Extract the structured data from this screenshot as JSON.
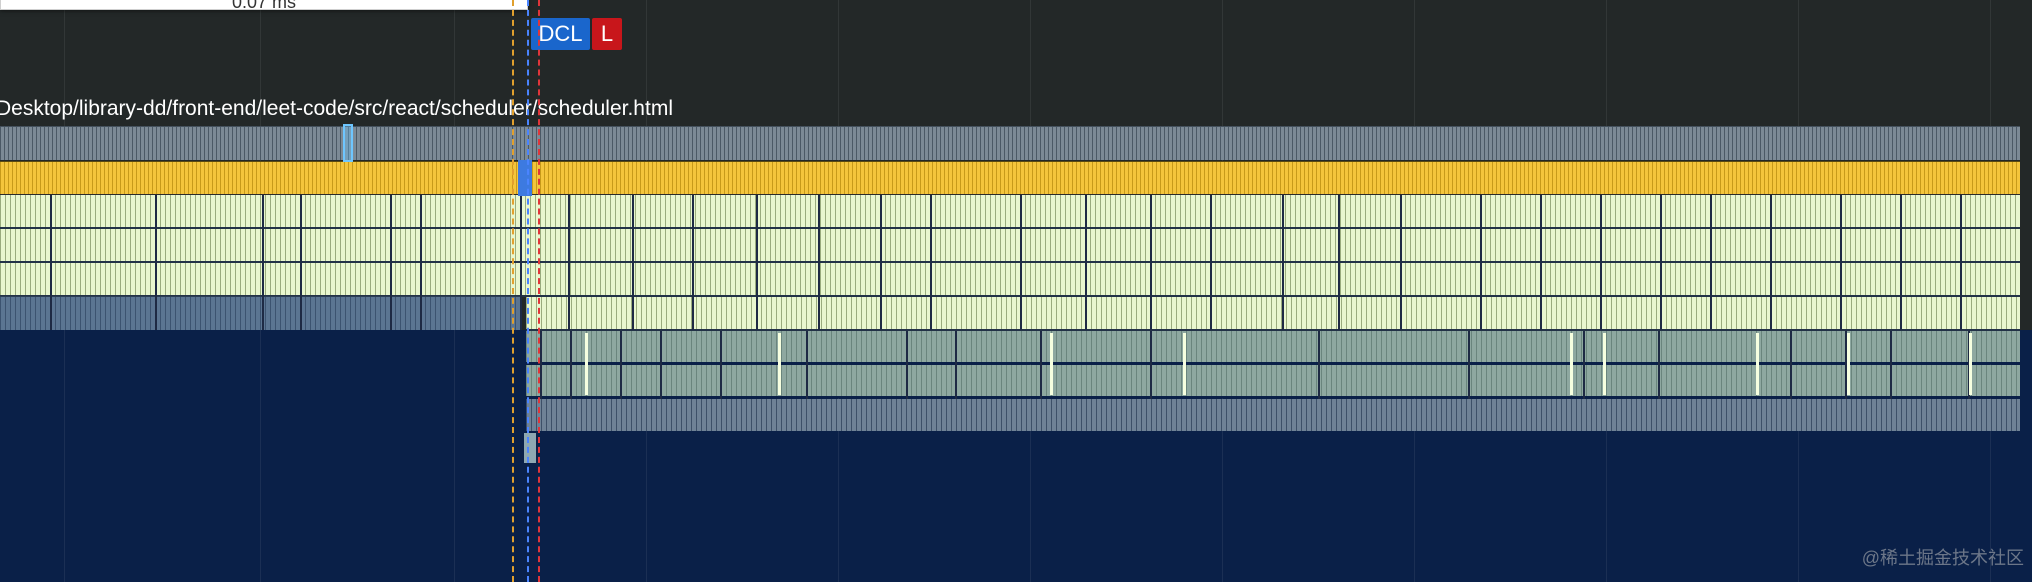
{
  "tooltip": {
    "text": "0.07 ms"
  },
  "markers": {
    "dcl_label": "DCL",
    "load_label": "L"
  },
  "main_thread": {
    "url": "Desktop/library-dd/front-end/leet-code/src/react/scheduler/scheduler.html"
  },
  "watermark": "@稀土掘金技术社区",
  "colors": {
    "background": "#232828",
    "timeline_dark": "#0a2048",
    "task_gray": "#7c8a96",
    "scripting_yellow": "#f4c53c",
    "function_call_lime": "#e9f7cf",
    "dcl_marker": "#1a66cc",
    "load_marker": "#c8161b"
  }
}
